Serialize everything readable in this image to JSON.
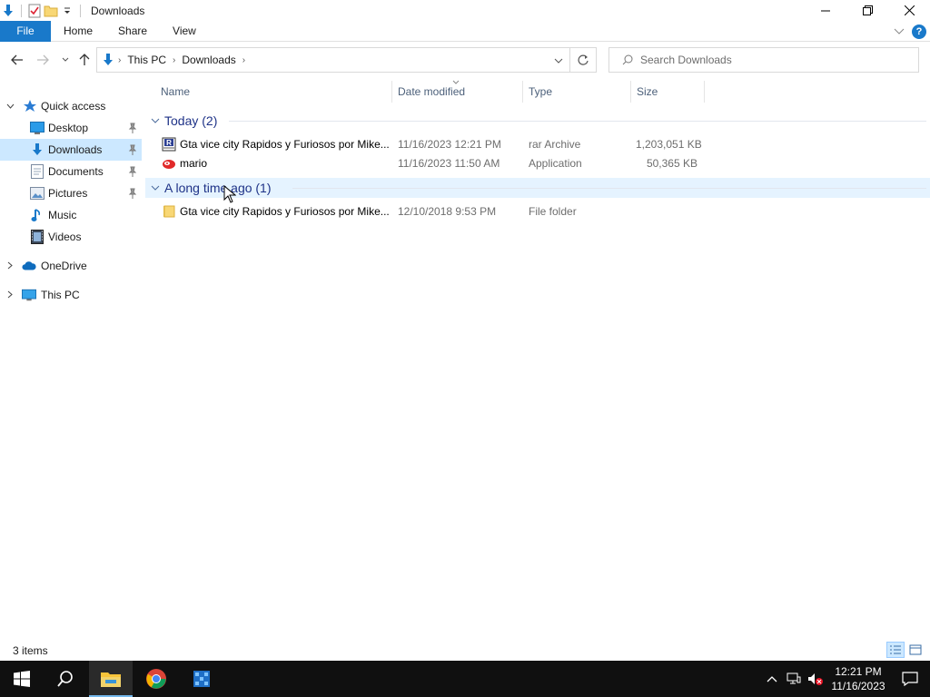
{
  "window": {
    "title": "Downloads",
    "controls": [
      "minimize-icon",
      "restore-icon",
      "close-icon"
    ]
  },
  "ribbon": {
    "tabs": [
      {
        "label": "File"
      },
      {
        "label": "Home"
      },
      {
        "label": "Share"
      },
      {
        "label": "View"
      }
    ]
  },
  "address": {
    "breadcrumbs": [
      "This PC",
      "Downloads"
    ]
  },
  "search": {
    "placeholder": "Search Downloads"
  },
  "nav": {
    "quick_access": "Quick access",
    "items": [
      {
        "label": "Desktop",
        "icon": "desktop-icon",
        "pinned": true
      },
      {
        "label": "Downloads",
        "icon": "downloads-icon",
        "pinned": true,
        "selected": true
      },
      {
        "label": "Documents",
        "icon": "documents-icon",
        "pinned": true
      },
      {
        "label": "Pictures",
        "icon": "pictures-icon",
        "pinned": true
      },
      {
        "label": "Music",
        "icon": "music-icon",
        "pinned": false
      },
      {
        "label": "Videos",
        "icon": "videos-icon",
        "pinned": false
      }
    ],
    "onedrive": "OneDrive",
    "this_pc": "This PC"
  },
  "columns": {
    "name": "Name",
    "date": "Date modified",
    "type": "Type",
    "size": "Size"
  },
  "groups": [
    {
      "label": "Today (2)",
      "files": [
        {
          "name": "Gta vice city Rapidos y Furiosos por Mike...",
          "date": "11/16/2023 12:21 PM",
          "type": "rar Archive",
          "size": "1,203,051 KB",
          "icon": "rar-archive-icon"
        },
        {
          "name": "mario",
          "date": "11/16/2023 11:50 AM",
          "type": "Application",
          "size": "50,365 KB",
          "icon": "mario-app-icon"
        }
      ]
    },
    {
      "label": "A long time ago (1)",
      "files": [
        {
          "name": "Gta vice city Rapidos y Furiosos por Mike...",
          "date": "12/10/2018 9:53 PM",
          "type": "File folder",
          "size": "",
          "icon": "folder-icon"
        }
      ]
    }
  ],
  "status": {
    "count": "3 items"
  },
  "taskbar": {
    "time": "12:21 PM",
    "date": "11/16/2023",
    "colors": {
      "background": "#101010",
      "accent": "#1979ca"
    }
  }
}
